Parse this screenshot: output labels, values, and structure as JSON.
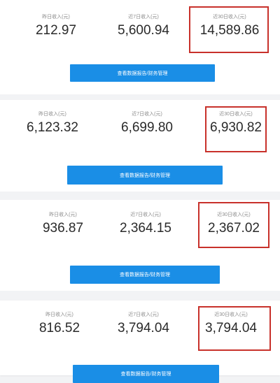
{
  "panels": [
    {
      "yesterday": {
        "label": "昨日收入(元)",
        "value": "212.97"
      },
      "week": {
        "label": "近7日收入(元)",
        "value": "5,600.94"
      },
      "month": {
        "label": "近30日收入(元)",
        "value": "14,589.86"
      },
      "button_label": "查看数据报告/财务管理"
    },
    {
      "yesterday": {
        "label": "昨日收入(元)",
        "value": "6,123.32"
      },
      "week": {
        "label": "近7日收入(元)",
        "value": "6,699.80"
      },
      "month": {
        "label": "近30日收入(元)",
        "value": "6,930.82"
      },
      "button_label": "查看数据报告/财务管理"
    },
    {
      "yesterday": {
        "label": "昨日收入(元)",
        "value": "936.87"
      },
      "week": {
        "label": "近7日收入(元)",
        "value": "2,364.15"
      },
      "month": {
        "label": "近30日收入(元)",
        "value": "2,367.02"
      },
      "button_label": "查看数据报告/财务管理"
    },
    {
      "yesterday": {
        "label": "昨日收入(元)",
        "value": "816.52"
      },
      "week": {
        "label": "近7日收入(元)",
        "value": "3,794.04"
      },
      "month": {
        "label": "近30日收入(元)",
        "value": "3,794.04"
      },
      "button_label": "查看数据报告/财务管理"
    }
  ],
  "colors": {
    "highlight_border": "#c8312b",
    "button_bg": "#1a8ee6",
    "page_bg": "#f2f3f5"
  }
}
